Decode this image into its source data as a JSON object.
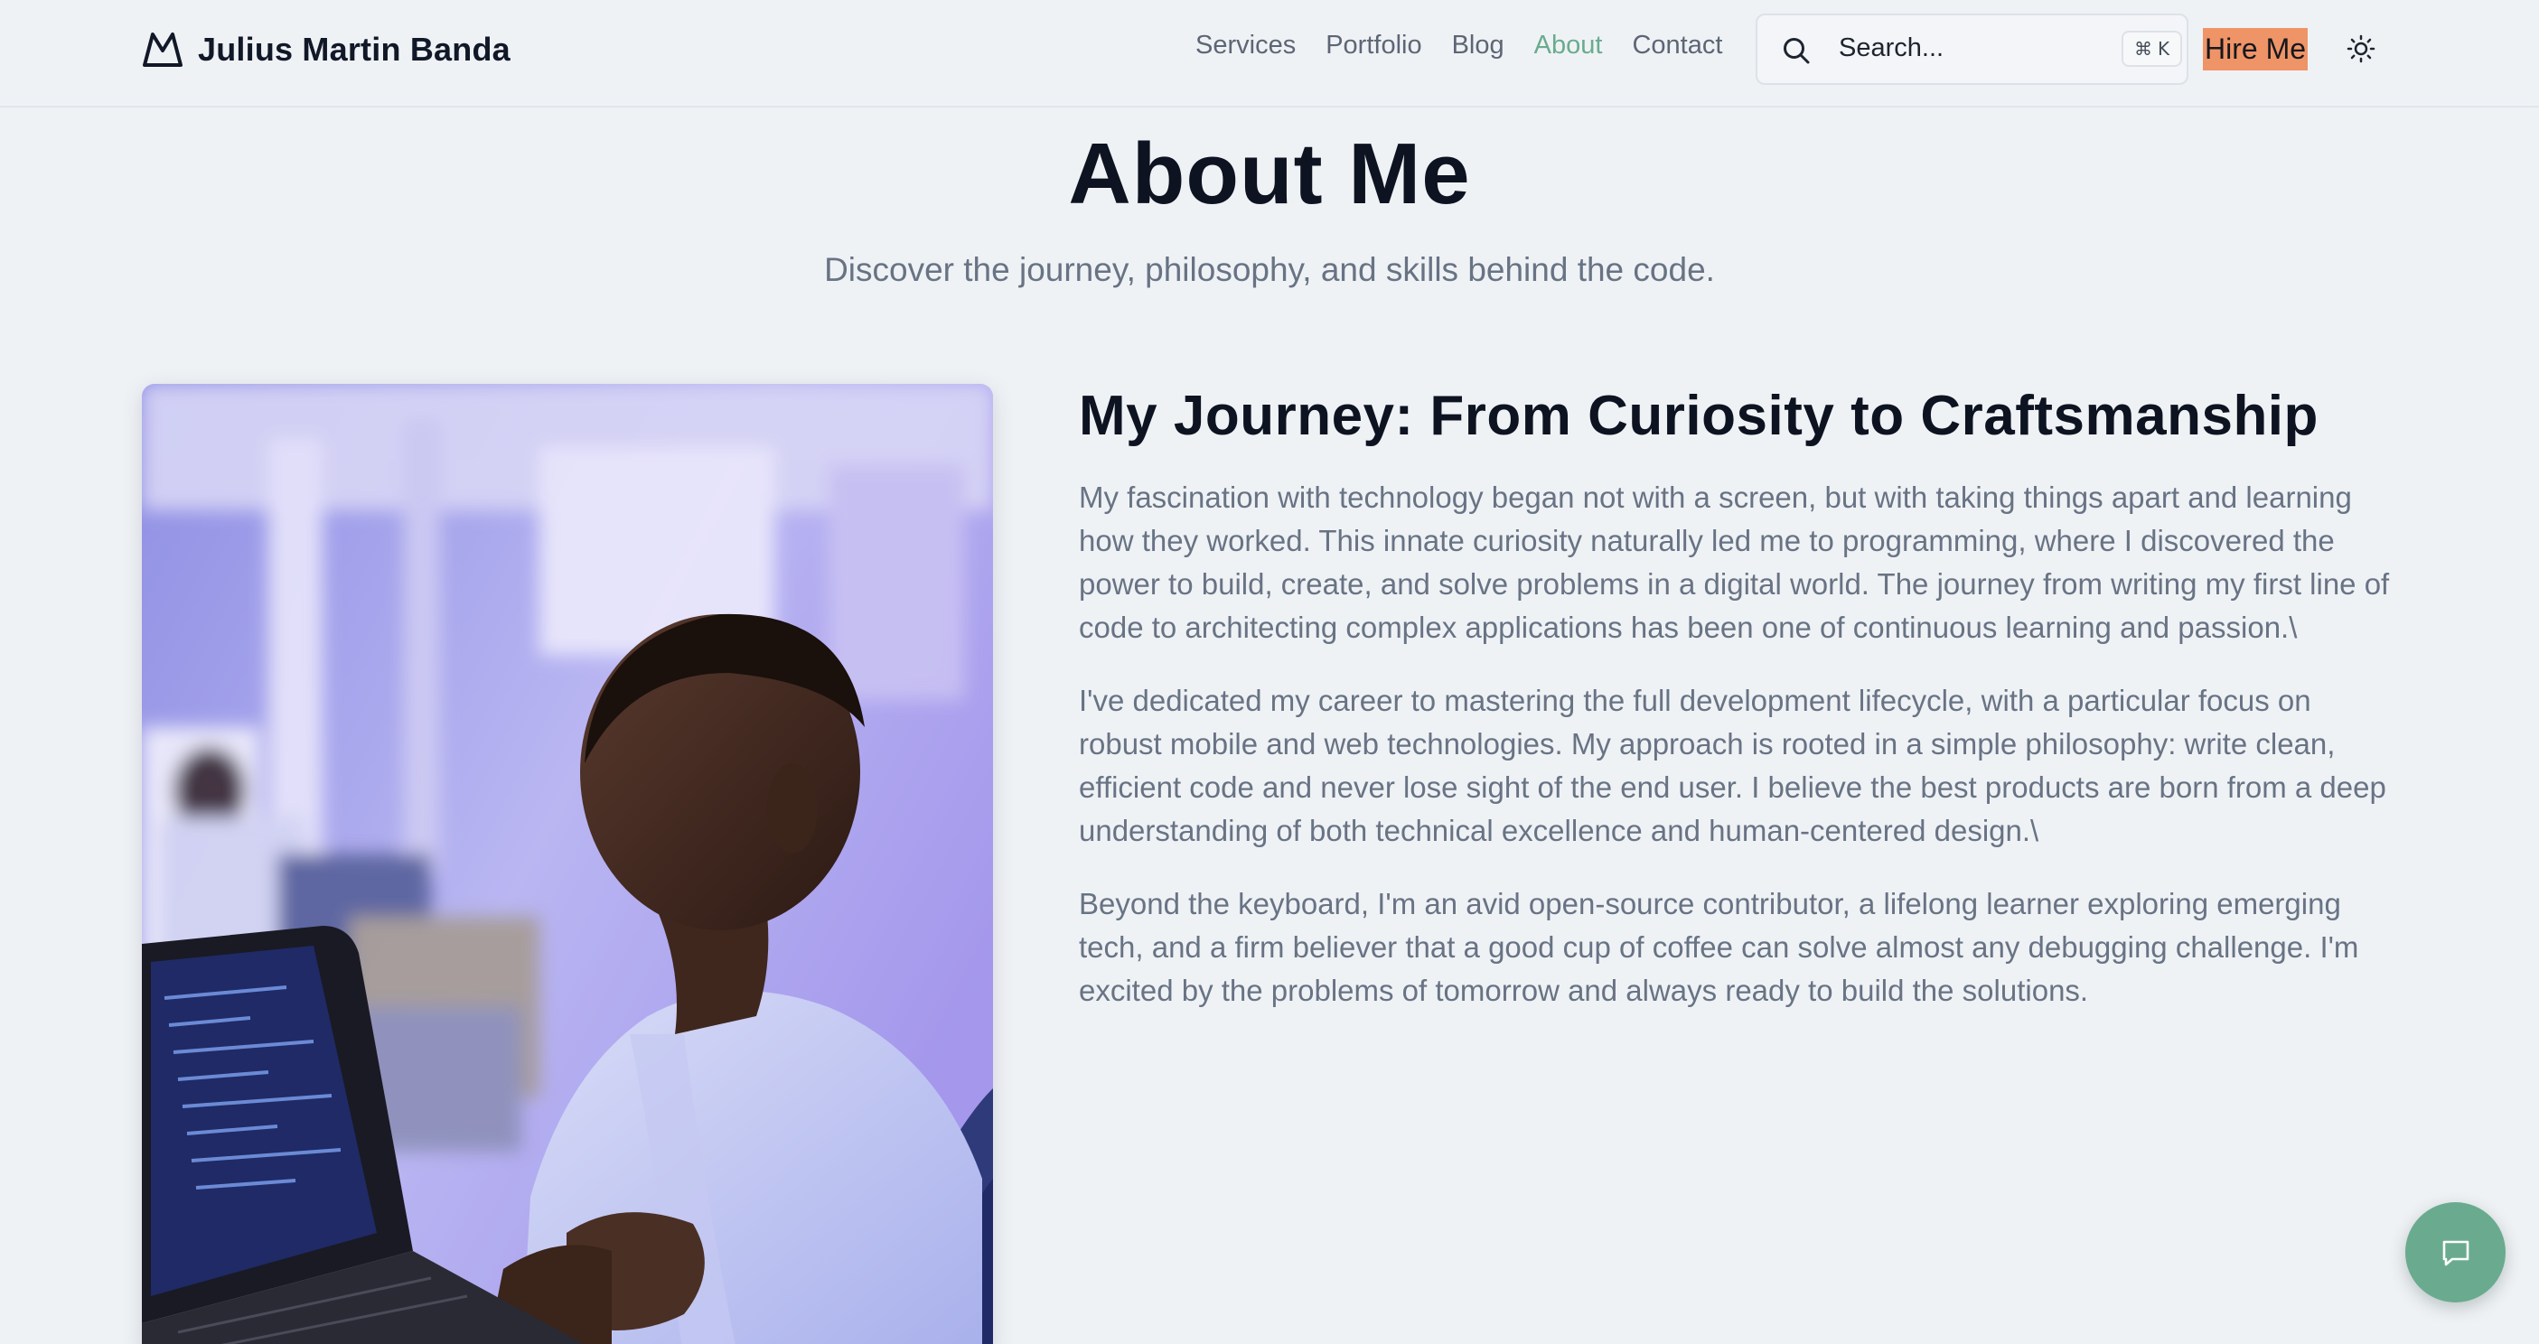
{
  "brand": {
    "name": "Julius Martin Banda",
    "logo_icon": "mountain-logo-icon"
  },
  "nav": {
    "items": [
      {
        "label": "Services",
        "active": false
      },
      {
        "label": "Portfolio",
        "active": false
      },
      {
        "label": "Blog",
        "active": false
      },
      {
        "label": "About",
        "active": true
      },
      {
        "label": "Contact",
        "active": false
      }
    ],
    "active_color": "#6aab8f"
  },
  "search": {
    "placeholder": "Search...",
    "shortcut_symbol": "⌘",
    "shortcut_key": "K",
    "icon": "search-icon"
  },
  "hire_button": {
    "label": "Hire Me",
    "color": "#ef9467"
  },
  "theme_toggle": {
    "icon": "sun-icon"
  },
  "hero": {
    "title": "About Me",
    "subtitle": "Discover the journey, philosophy, and skills behind the code."
  },
  "photo": {
    "alt": "Man working on a laptop in an office"
  },
  "journey": {
    "title": "My Journey: From Curiosity to Craftsmanship",
    "paragraphs": [
      "My fascination with technology began not with a screen, but with taking things apart and learning how they worked. This innate curiosity naturally led me to programming, where I discovered the power to build, create, and solve problems in a digital world. The journey from writing my first line of code to architecting complex applications has been one of continuous learning and passion.\\",
      "I've dedicated my career to mastering the full development lifecycle, with a particular focus on robust mobile and web technologies. My approach is rooted in a simple philosophy: write clean, efficient code and never lose sight of the end user. I believe the best products are born from a deep understanding of both technical excellence and human-centered design.\\",
      "Beyond the keyboard, I'm an avid open-source contributor, a lifelong learner exploring emerging tech, and a firm believer that a good cup of coffee can solve almost any debugging challenge. I'm excited by the problems of tomorrow and always ready to build the solutions."
    ]
  },
  "chat_fab": {
    "icon": "chat-bubble-icon",
    "color": "#6aab8f"
  }
}
